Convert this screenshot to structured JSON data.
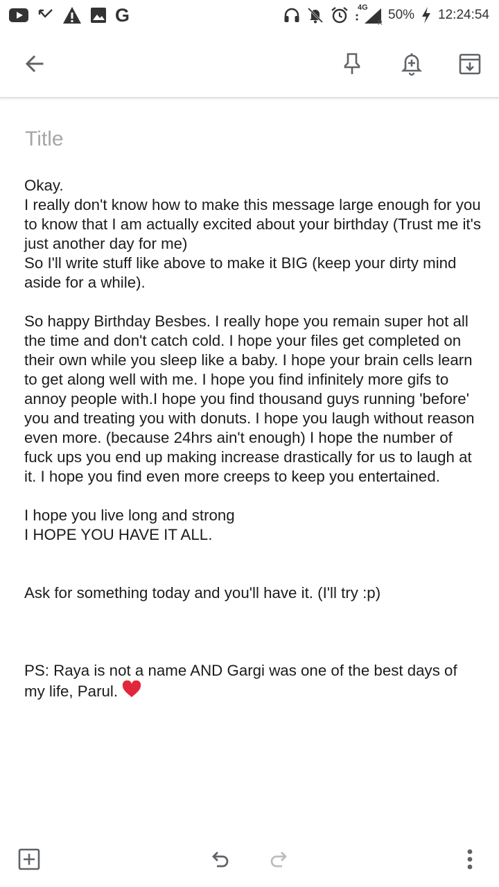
{
  "status_bar": {
    "network_label": "4G",
    "roaming_label": "R",
    "battery_percent": "50%",
    "time": "12:24:54",
    "left_icons": [
      "youtube-icon",
      "missed-call-icon",
      "warning-icon",
      "image-icon",
      "google-icon"
    ],
    "right_icons": [
      "headphones-icon",
      "bell-off-icon",
      "alarm-icon",
      "signal-icon",
      "battery-charging-icon"
    ],
    "google_letter": "G"
  },
  "toolbar": {
    "icons": [
      "back-arrow-icon",
      "pin-icon",
      "reminder-icon",
      "archive-icon"
    ]
  },
  "note": {
    "title_placeholder": "Title",
    "body_main": "Okay.\nI really don't know how to make this message large enough for you to know that I am actually excited about your birthday (Trust me it's just another day for me)\nSo I'll write stuff like above to make it BIG (keep your dirty mind aside for a while).\n\nSo happy Birthday Besbes. I really hope you remain super hot all the time and don't catch cold. I hope your files get completed on their own while you sleep like a baby. I hope your brain cells learn to get along well with me. I hope you find infinitely more gifs to annoy people with.I hope you find thousand guys running 'before' you and treating you with donuts. I hope you laugh without reason even more. (because 24hrs ain't enough) I hope the number of fuck ups you end up making increase drastically for us to laugh at it. I hope you find even more creeps to keep you entertained.\n\nI hope you live long and strong\nI HOPE YOU HAVE IT ALL.\n\n\nAsk for something today and you'll have it. (I'll try :p)\n\n\n\nPS: Raya is not a name AND Gargi was one of the best days of my life, Parul.",
    "heart_icon": "heart-emoji-icon"
  },
  "bottom_bar": {
    "icons": [
      "add-box-icon",
      "undo-icon",
      "redo-icon",
      "more-vert-icon"
    ]
  },
  "colors": {
    "icon": "#5f6368",
    "title_placeholder": "#a6a6a6",
    "heart": "#e0283a"
  }
}
